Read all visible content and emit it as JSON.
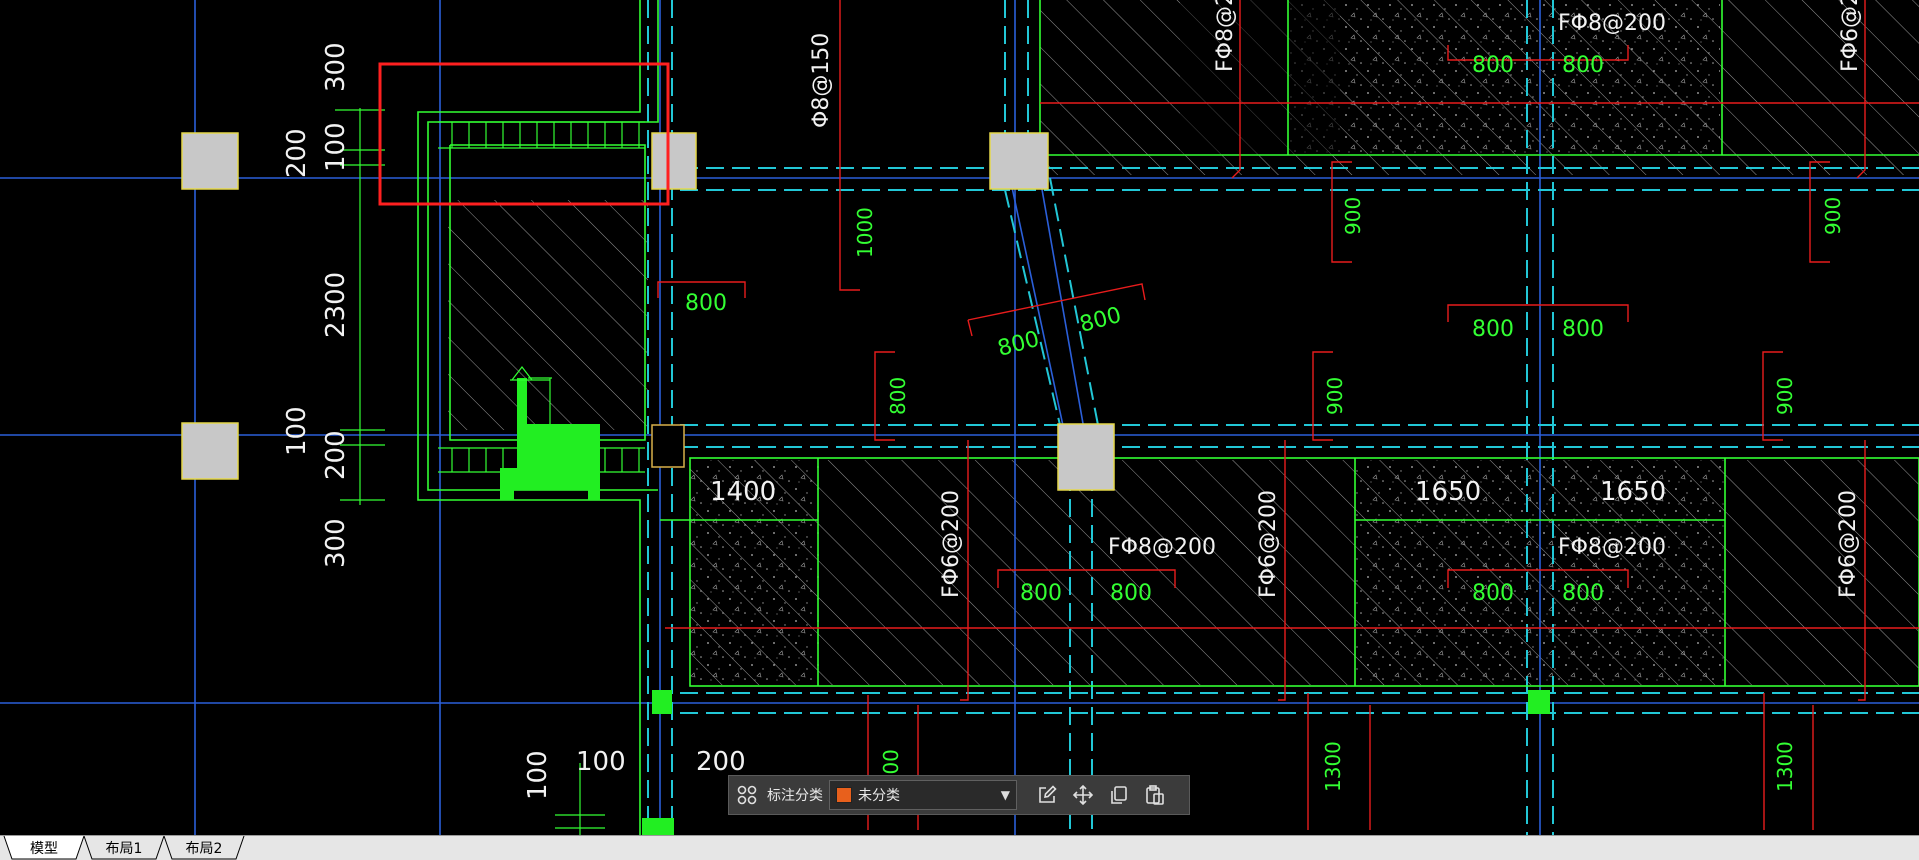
{
  "drawing": {
    "dims_left": [
      "300",
      "200",
      "100",
      "2300",
      "100",
      "200",
      "300"
    ],
    "rebar_labels": {
      "top_vertical": "Φ8@150",
      "fphi8_200_a": "FΦ8@200",
      "fphi8_200_b": "FΦ8@200",
      "fphi8_200_c": "FΦ8@200",
      "fphi8_top_partial": "FΦ8@2",
      "fphi6_top_right": "FΦ6@2",
      "fphi6_200_a": "FΦ6@200",
      "fphi6_200_b": "FΦ6@200",
      "fphi6_200_c": "FΦ6@200"
    },
    "panel_dims": {
      "w1400": "1400",
      "w1650a": "1650",
      "w1650b": "1650"
    },
    "bottom_dims": {
      "d100a": "100",
      "d200": "200",
      "d100b": "100"
    },
    "green_dims": {
      "v1000": "1000",
      "h800": "800",
      "v800": "800",
      "diag800a": "800",
      "diag800b": "800",
      "top800a": "800",
      "top800b": "800",
      "mid800a": "800",
      "mid800b": "800",
      "low800a": "800",
      "low800b": "800",
      "low800c": "800",
      "low800d": "800",
      "v900a": "900",
      "v900b": "900",
      "v900c": "900",
      "v900d": "900",
      "v1300a": "1300",
      "v1300b": "1300",
      "v1200": "1200"
    }
  },
  "toolbar": {
    "label": "标注分类",
    "category_value": "未分类",
    "category_color": "#e8601c",
    "icons": [
      "layout-icon",
      "edit-icon",
      "move-icon",
      "copy-icon",
      "paste-icon"
    ]
  },
  "tabs": [
    "模型",
    "布局1",
    "布局2"
  ],
  "colors": {
    "background": "#000000",
    "axis_blue": "#2b5fd9",
    "cyan": "#22c7d6",
    "green": "#33ff33",
    "red": "#e81c1c",
    "column_gray": "#c8c8c8",
    "highlight_red": "#ff2020"
  }
}
